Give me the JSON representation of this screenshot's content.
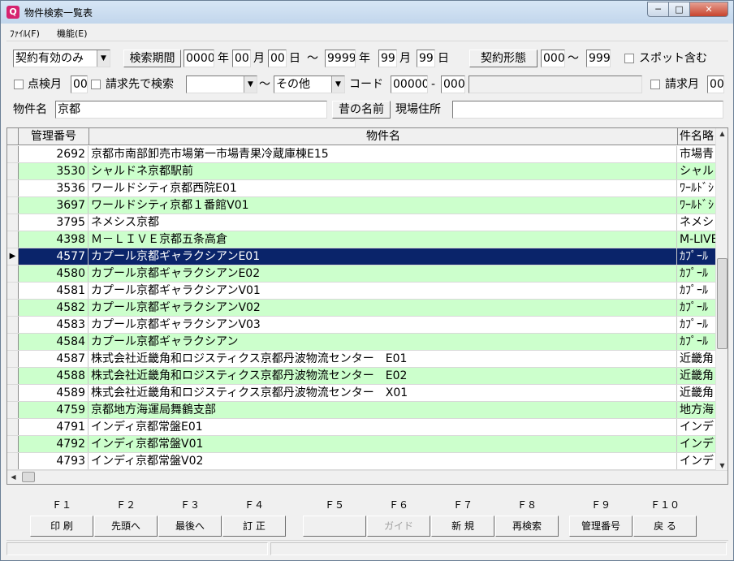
{
  "window": {
    "title": "物件検索一覧表",
    "min_glyph": "─",
    "max_glyph": "□",
    "close_glyph": "✕"
  },
  "menu": {
    "file": "ﾌｧｲﾙ(F)",
    "function": "機能(E)"
  },
  "filters": {
    "contract_status": "契約有効のみ",
    "search_period_label": "検索期間",
    "period_from_year": "0000",
    "period_from_month": "00",
    "period_from_day": "00",
    "period_to_year": "9999",
    "period_to_month": "99",
    "period_to_day": "99",
    "year_label": "年",
    "month_label": "月",
    "day_label": "日",
    "tilde": "～",
    "contract_type_label": "契約形態",
    "contract_type_from": "000",
    "contract_type_to": "999",
    "spot_label": "スポット含む",
    "inspection_month_label": "点検月",
    "inspection_month_value": "00",
    "billing_search_label": "請求先で検索",
    "billing_from": "",
    "billing_to": "その他",
    "code_label": "コード",
    "code_value": "00000",
    "code_dash": "-",
    "code_sub": "000",
    "code_name": "",
    "billing_month_label": "請求月",
    "billing_month_value": "00",
    "property_name_label": "物件名",
    "property_name_value": "京都",
    "old_name_button": "昔の名前",
    "site_address_label": "現場住所",
    "site_address_value": ""
  },
  "grid": {
    "headers": {
      "number": "管理番号",
      "name": "物件名",
      "short": "件名略"
    },
    "current_marker": "▶",
    "rows": [
      {
        "number": "2692",
        "name": "京都市南部卸売市場第一市場青果冷蔵庫棟E15",
        "short": "市場青"
      },
      {
        "number": "3530",
        "name": "シャルドネ京都駅前",
        "short": "シャル"
      },
      {
        "number": "3536",
        "name": "ワールドシティ京都西院E01",
        "short": "ﾜｰﾙﾄﾞｼ"
      },
      {
        "number": "3697",
        "name": "ワールドシティ京都１番館V01",
        "short": "ﾜｰﾙﾄﾞｼ"
      },
      {
        "number": "3795",
        "name": "ネメシス京都",
        "short": "ネメシ"
      },
      {
        "number": "4398",
        "name": "Ｍ－ＬＩＶＥ京都五条高倉",
        "short": "M-LIVE"
      },
      {
        "number": "4577",
        "name": "カプール京都ギャラクシアンE01",
        "short": "ｶﾌﾟｰﾙ"
      },
      {
        "number": "4580",
        "name": "カプール京都ギャラクシアンE02",
        "short": "ｶﾌﾟｰﾙ"
      },
      {
        "number": "4581",
        "name": "カプール京都ギャラクシアンV01",
        "short": "ｶﾌﾟｰﾙ"
      },
      {
        "number": "4582",
        "name": "カプール京都ギャラクシアンV02",
        "short": "ｶﾌﾟｰﾙ"
      },
      {
        "number": "4583",
        "name": "カプール京都ギャラクシアンV03",
        "short": "ｶﾌﾟｰﾙ"
      },
      {
        "number": "4584",
        "name": "カプール京都ギャラクシアン",
        "short": "ｶﾌﾟｰﾙ"
      },
      {
        "number": "4587",
        "name": "株式会社近畿角和ロジスティクス京都丹波物流センター　E01",
        "short": "近畿角"
      },
      {
        "number": "4588",
        "name": "株式会社近畿角和ロジスティクス京都丹波物流センター　E02",
        "short": "近畿角"
      },
      {
        "number": "4589",
        "name": "株式会社近畿角和ロジスティクス京都丹波物流センター　X01",
        "short": "近畿角"
      },
      {
        "number": "4759",
        "name": "京都地方海運局舞鶴支部",
        "short": "地方海"
      },
      {
        "number": "4791",
        "name": "インディ京都常盤E01",
        "short": "インデ"
      },
      {
        "number": "4792",
        "name": "インディ京都常盤V01",
        "short": "インデ"
      },
      {
        "number": "4793",
        "name": "インディ京都常盤V02",
        "short": "インデ"
      }
    ]
  },
  "function_keys": [
    {
      "key": "Ｆ１",
      "label": "印 刷"
    },
    {
      "key": "Ｆ２",
      "label": "先頭へ"
    },
    {
      "key": "Ｆ３",
      "label": "最後へ"
    },
    {
      "key": "Ｆ４",
      "label": "訂 正"
    },
    {
      "key": "Ｆ５",
      "label": ""
    },
    {
      "key": "Ｆ６",
      "label": "ガイド"
    },
    {
      "key": "Ｆ７",
      "label": "新 規"
    },
    {
      "key": "Ｆ８",
      "label": "再検索"
    },
    {
      "key": "Ｆ９",
      "label": "管理番号"
    },
    {
      "key": "Ｆ１０",
      "label": "戻 る"
    }
  ]
}
